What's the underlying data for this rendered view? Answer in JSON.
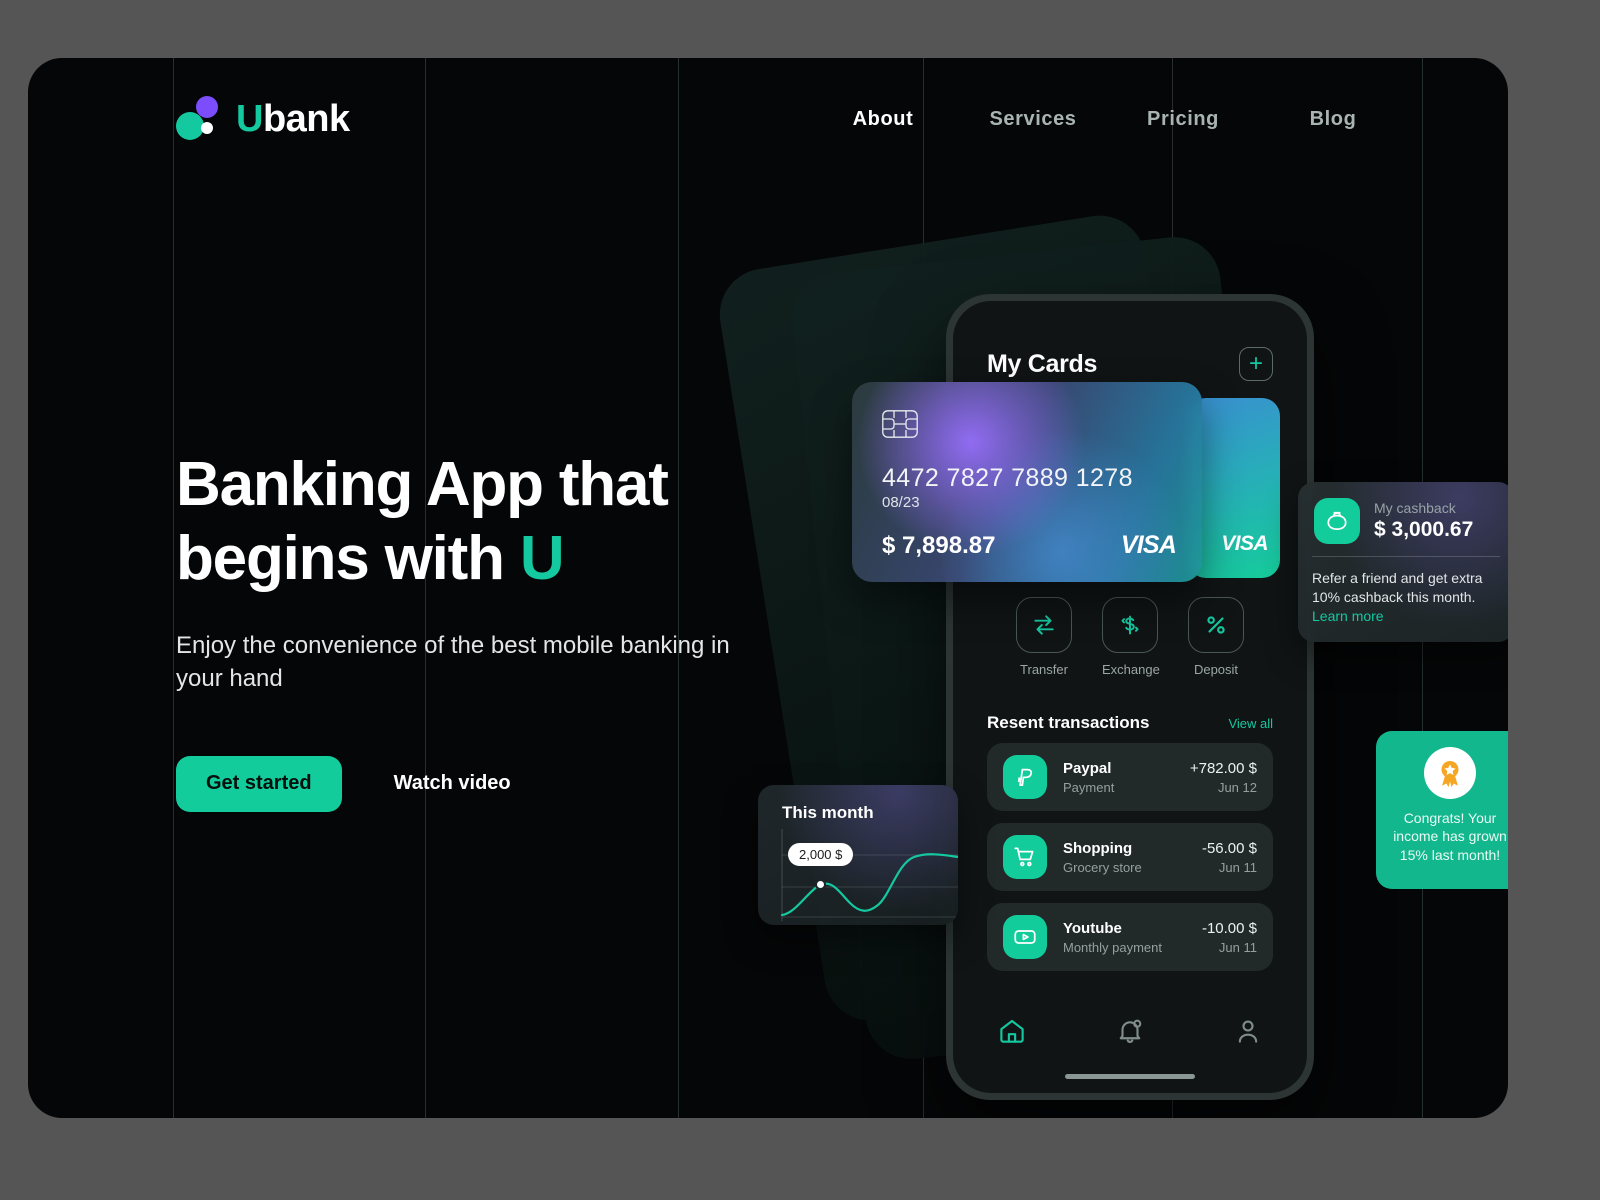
{
  "brand": {
    "name_u": "U",
    "name_rest": "bank",
    "logo_icon": "three-dots-logo"
  },
  "nav": {
    "items": [
      {
        "label": "About",
        "active": true
      },
      {
        "label": "Services",
        "active": false
      },
      {
        "label": "Pricing",
        "active": false
      },
      {
        "label": "Blog",
        "active": false
      }
    ]
  },
  "hero": {
    "title_line1": "Banking App that",
    "title_line2_pre": "begins with ",
    "title_line2_accent": "U",
    "subtitle": "Enjoy the convenience of the best mobile banking in your hand",
    "primary_cta": "Get started",
    "secondary_cta": "Watch video"
  },
  "phone": {
    "title": "My Cards",
    "add_button": "+",
    "card": {
      "number": "4472 7827 7889 1278",
      "expiry": "08/23",
      "balance": "$ 7,898.87",
      "brand": "VISA",
      "chip_icon": "chip-icon"
    },
    "card_secondary": {
      "brand": "VISA"
    },
    "actions": [
      {
        "label": "Transfer",
        "icon": "transfer-arrows-icon"
      },
      {
        "label": "Exchange",
        "icon": "exchange-dollar-icon"
      },
      {
        "label": "Deposit",
        "icon": "percent-icon"
      }
    ],
    "transactions": {
      "title": "Resent transactions",
      "view_all": "View all",
      "rows": [
        {
          "name": "Paypal",
          "sub": "Payment",
          "amount": "+782.00 $",
          "date": "Jun 12",
          "icon": "paypal-icon"
        },
        {
          "name": "Shopping",
          "sub": "Grocery store",
          "amount": "-56.00 $",
          "date": "Jun 11",
          "icon": "shopping-cart-icon"
        },
        {
          "name": "Youtube",
          "sub": "Monthly payment",
          "amount": "-10.00 $",
          "date": "Jun 11",
          "icon": "youtube-icon"
        }
      ]
    },
    "bottom_nav": [
      {
        "icon": "home-icon",
        "active": true
      },
      {
        "icon": "bell-icon",
        "active": false
      },
      {
        "icon": "user-profile-icon",
        "active": false
      }
    ]
  },
  "cashback": {
    "label": "My cashback",
    "amount": "$ 3,000.67",
    "body": "Refer a friend and get extra 10% cashback this month.",
    "link": "Learn more",
    "icon": "wallet-purse-icon"
  },
  "congrats": {
    "text": "Congrats! Your income has grown 15% last month!",
    "icon": "award-ribbon-icon"
  },
  "this_month": {
    "title": "This month",
    "tooltip": "2,000 $"
  },
  "colors": {
    "accent_green": "#13cc9c",
    "accent_purple": "#7c4dfd",
    "canvas_bg": "#050607",
    "outer_bg": "#555555",
    "card_surface": "#212a29"
  },
  "chart_data": {
    "type": "line",
    "title": "This month",
    "x": [
      0,
      1,
      2,
      3,
      4,
      5,
      6,
      7,
      8
    ],
    "values": [
      400,
      1200,
      2000,
      1700,
      1050,
      900,
      1500,
      2450,
      2600
    ],
    "annotations": [
      {
        "label": "2,000 $",
        "x": 2,
        "y": 2000
      }
    ],
    "xlabel": "",
    "ylabel": "",
    "ylim": [
      0,
      3000
    ],
    "grid": true,
    "legend": "none",
    "series_color": "#14c8a0"
  }
}
